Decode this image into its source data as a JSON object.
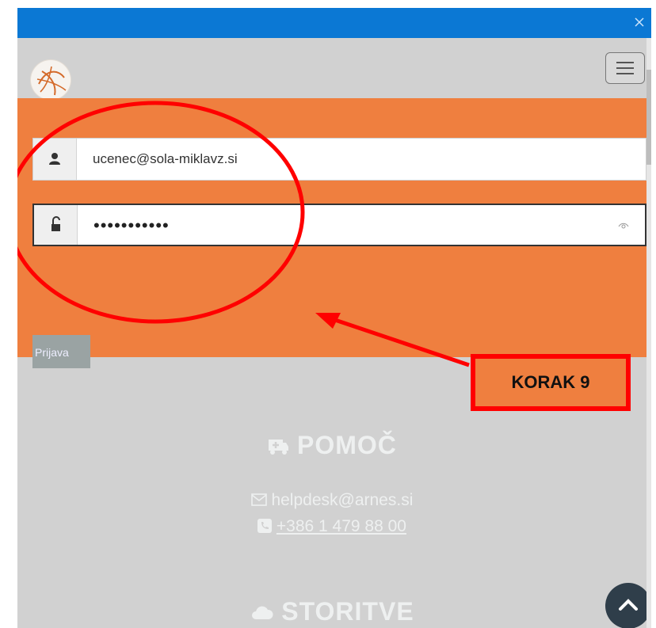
{
  "window": {
    "close_label": "×"
  },
  "header": {
    "logo": "arnes-logo",
    "menu_icon": "hamburger-menu-icon"
  },
  "login": {
    "username_value": "ucenec@sola-miklavz.si",
    "password_value": "•••••••••••",
    "submit_label": "Prijava",
    "username_icon": "user-icon",
    "password_icon": "unlock-icon",
    "reveal_icon": "eye-icon"
  },
  "annotation": {
    "callout_text": "KORAK 9"
  },
  "help": {
    "title": "POMOČ",
    "email": "helpdesk@arnes.si",
    "phone": "+386 1 479 88 00",
    "title_icon": "ambulance-icon",
    "email_icon": "envelope-icon",
    "phone_icon": "phone-icon"
  },
  "services": {
    "title": "STORITVE",
    "title_icon": "cloud-icon"
  },
  "colors": {
    "titlebar": "#0b78d4",
    "orange_band": "#ef7f3f",
    "annotation": "#ff0000",
    "page_bg": "#d1d1d1"
  }
}
